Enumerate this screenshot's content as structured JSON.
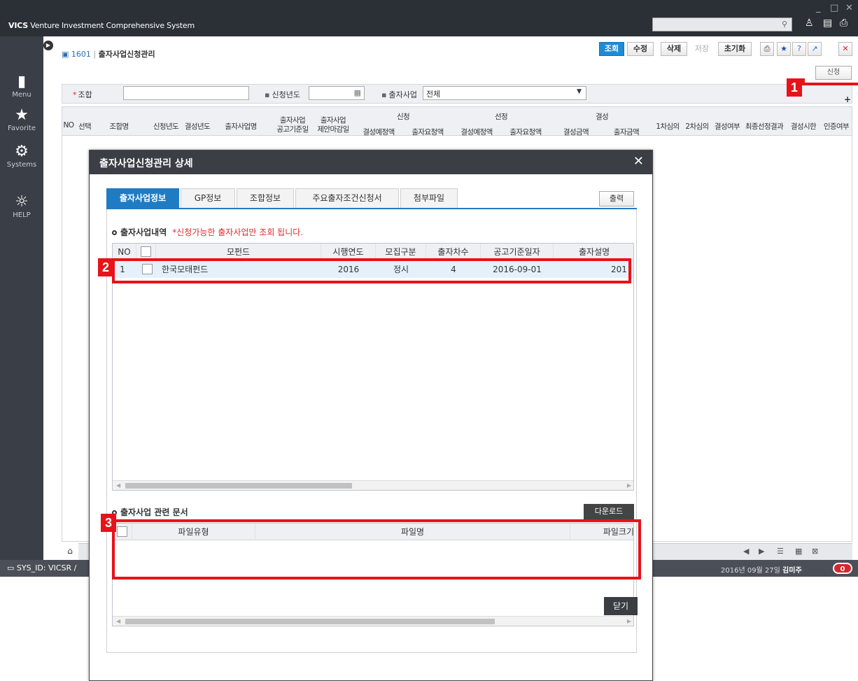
{
  "app": {
    "title_bold": "VICS",
    "title_rest": " Venture Investment Comprehensive System"
  },
  "sidebar": {
    "items": [
      {
        "label": "Menu",
        "icon": "menu-book-icon"
      },
      {
        "label": "Favorite",
        "icon": "star-icon"
      },
      {
        "label": "Systems",
        "icon": "gears-icon"
      },
      {
        "label": "HELP",
        "icon": "lightbulb-icon"
      }
    ]
  },
  "breadcrumb": {
    "code": "1601",
    "title": "출자사업신청관리"
  },
  "toolbar": {
    "search_label": "조회",
    "edit_label": "수정",
    "delete_label": "삭제",
    "save_label": "저장",
    "reset_label": "초기화",
    "apply_label": "신청"
  },
  "filters": {
    "union_label": "조합",
    "union_value": "",
    "year_label": "신청년도",
    "year_value": "",
    "business_label": "출자사업",
    "business_value": "전체"
  },
  "main_grid": {
    "headers": {
      "no": "NO",
      "select": "선택",
      "union_name": "조합명",
      "apply_year": "신청년도",
      "settle_year": "결성년도",
      "business_name": "출자사업명",
      "notice_top": "출자사업",
      "notice_bottom": "공고기준일",
      "deadline_top": "출자사업",
      "deadline_bottom": "제안마감일",
      "apply_group": "신청",
      "apply_planned": "결성예정액",
      "apply_request": "출자요청액",
      "select_group": "선정",
      "select_planned": "결성예정액",
      "select_request": "출자요청액",
      "settle_group": "결성",
      "settle_amount": "결성금액",
      "settle_invest": "출자금액",
      "first_review": "1차심의",
      "second_review": "2차심의",
      "settled_yn": "결성여부",
      "final_result": "최종선정결과",
      "settle_deadline": "결성시한",
      "cert_yn": "인증여부"
    }
  },
  "status": {
    "sys_id": "SYS_ID: VICSR /",
    "date_prefix": "2016년 09월 27일",
    "user": "김미주",
    "badge": "0"
  },
  "modal": {
    "title": "출자사업신청관리 상세",
    "tabs": [
      "출자사업정보",
      "GP정보",
      "조합정보",
      "주요출자조건신청서",
      "첨부파일"
    ],
    "active_tab": 0,
    "print_label": "출력",
    "section1_title": "출자사업내역",
    "section1_note": "*신청가능한 출자사업만 조회 됩니다.",
    "table1": {
      "headers": [
        "NO",
        "",
        "모펀드",
        "시행연도",
        "모집구분",
        "출자차수",
        "공고기준일자",
        "출자설명"
      ],
      "rows": [
        {
          "no": "1",
          "fund": "한국모태펀드",
          "year": "2016",
          "type": "정시",
          "round": "4",
          "date": "2016-09-01",
          "desc": "201"
        }
      ]
    },
    "section2_title": "출자사업 관련 문서",
    "download_label": "다운로드",
    "table2": {
      "headers": [
        "파일유형",
        "파일명",
        "파일크기"
      ]
    },
    "close_label": "닫기"
  },
  "callouts": [
    "1",
    "2",
    "3"
  ],
  "colors": {
    "accent": "#1f7cc3",
    "primary_button": "#1f8bd6",
    "callout": "#e8121a",
    "note": "#e0282e"
  }
}
